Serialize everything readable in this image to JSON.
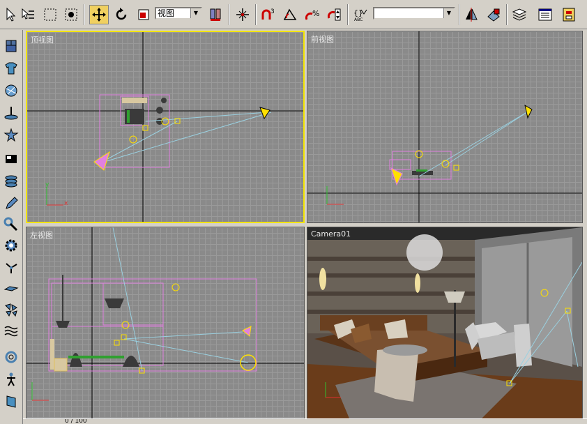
{
  "toolbar": {
    "reference_coord": "视图",
    "named_selection": "",
    "tools": [
      {
        "name": "select-icon"
      },
      {
        "name": "region-select-icon"
      },
      {
        "name": "window-crossing-icon"
      },
      {
        "name": "move-icon",
        "active": true
      },
      {
        "name": "rotate-icon"
      },
      {
        "name": "scale-icon"
      },
      {
        "name": "pivot-icon"
      },
      {
        "name": "select-manipulate-icon"
      },
      {
        "name": "snap-3d-icon",
        "label": "3"
      },
      {
        "name": "angle-snap-icon"
      },
      {
        "name": "percent-snap-icon"
      },
      {
        "name": "spinner-snap-icon"
      },
      {
        "name": "edit-named-selection-icon"
      },
      {
        "name": "mirror-icon"
      },
      {
        "name": "align-icon"
      },
      {
        "name": "layer-manager-icon"
      },
      {
        "name": "curve-editor-icon"
      },
      {
        "name": "schematic-view-icon"
      }
    ]
  },
  "viewports": {
    "top": {
      "label": "顶视图",
      "active": true
    },
    "front": {
      "label": "前视图"
    },
    "left": {
      "label": "左视图"
    },
    "camera": {
      "label": "Camera01"
    }
  },
  "axis": {
    "x": "x",
    "y": "y"
  },
  "statusbar": {
    "text": "0 / 100"
  },
  "colors": {
    "grid_bg": "#8a8a8a",
    "grid_line": "#9a9a9a",
    "active_border": "#f2e400",
    "wireframe": "#e080e0",
    "camera_line": "#9ad0e0",
    "helper": "#ffe000"
  }
}
